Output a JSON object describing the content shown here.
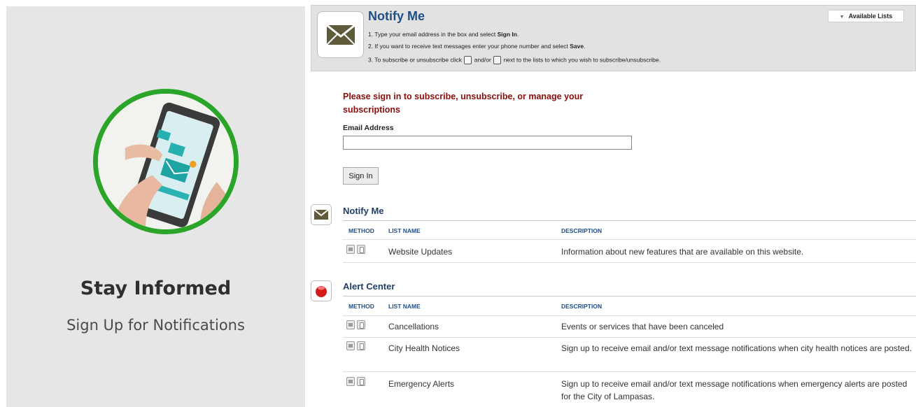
{
  "promo": {
    "title": "Stay Informed",
    "subtitle": "Sign Up for Notifications",
    "image_label": "You received a message!"
  },
  "header": {
    "title": "Notify Me",
    "step1": {
      "prefix": "1. Type your email address in the box and select ",
      "bold": "Sign In",
      "suffix": "."
    },
    "step2": {
      "prefix": "2. If you want to receive text messages enter your phone number and select ",
      "bold": "Save",
      "suffix": "."
    },
    "step3": {
      "prefix": "3. To subscribe or unsubscribe click ",
      "middle": " and/or ",
      "suffix": " next to the lists to which you wish to subscribe/unsubscribe."
    },
    "available_lists_label": "Available Lists"
  },
  "signin": {
    "message": "Please sign in to subscribe, unsubscribe, or manage your subscriptions",
    "email_label": "Email Address",
    "email_value": "",
    "button_label": "Sign In"
  },
  "columns": {
    "method": "METHOD",
    "list_name": "LIST NAME",
    "description": "DESCRIPTION"
  },
  "sections": [
    {
      "title": "Notify Me",
      "icon": "envelope-icon",
      "rows": [
        {
          "name": "Website Updates",
          "description": "Information about new features that are available on this website."
        }
      ]
    },
    {
      "title": "Alert Center",
      "icon": "alert-icon",
      "rows": [
        {
          "name": "Cancellations",
          "description": "Events or services that have been canceled"
        },
        {
          "name": "City Health Notices",
          "description": "Sign up to receive email and/or text message notifications when city health notices are posted."
        },
        {
          "name": "Emergency Alerts",
          "description": "Sign up to receive email and/or text message notifications when emergency alerts are posted for the City of Lampasas."
        }
      ]
    }
  ],
  "colors": {
    "accent_blue": "#1e4f86",
    "signin_red": "#8b0d0d",
    "promo_green": "#2aa52a",
    "alert_red": "#d41a1a"
  }
}
